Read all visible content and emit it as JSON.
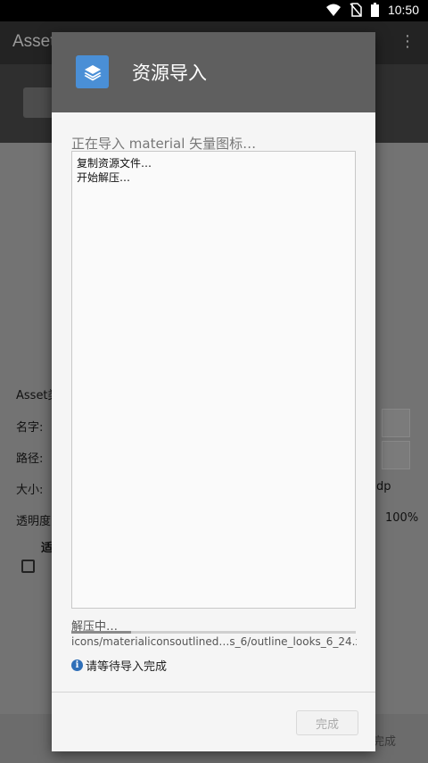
{
  "status_bar": {
    "time": "10:50"
  },
  "background": {
    "app_title": "Asset",
    "menu_icon": "more-vert-icon",
    "form": {
      "type_label": "Asset类",
      "name_label": "名字:",
      "path_label": "路径:",
      "size_label": "大小:",
      "opacity_label": "透明度:",
      "checkbox_label": "适",
      "size_unit": "dp",
      "opacity_value": "100%",
      "done_label": "完成"
    }
  },
  "dialog": {
    "title": "资源导入",
    "icon": "layers-icon",
    "accent_color": "#4a8fd6",
    "progress_text": "正在导入 material 矢量图标…",
    "log_lines": [
      "复制资源文件…",
      "开始解压…"
    ],
    "status_text": "解压中…",
    "progress_fraction": 0.21,
    "current_file": "icons/materialiconsoutlined…s_6/outline_looks_6_24.xml",
    "info_text": "请等待导入完成",
    "done_button": "完成"
  }
}
